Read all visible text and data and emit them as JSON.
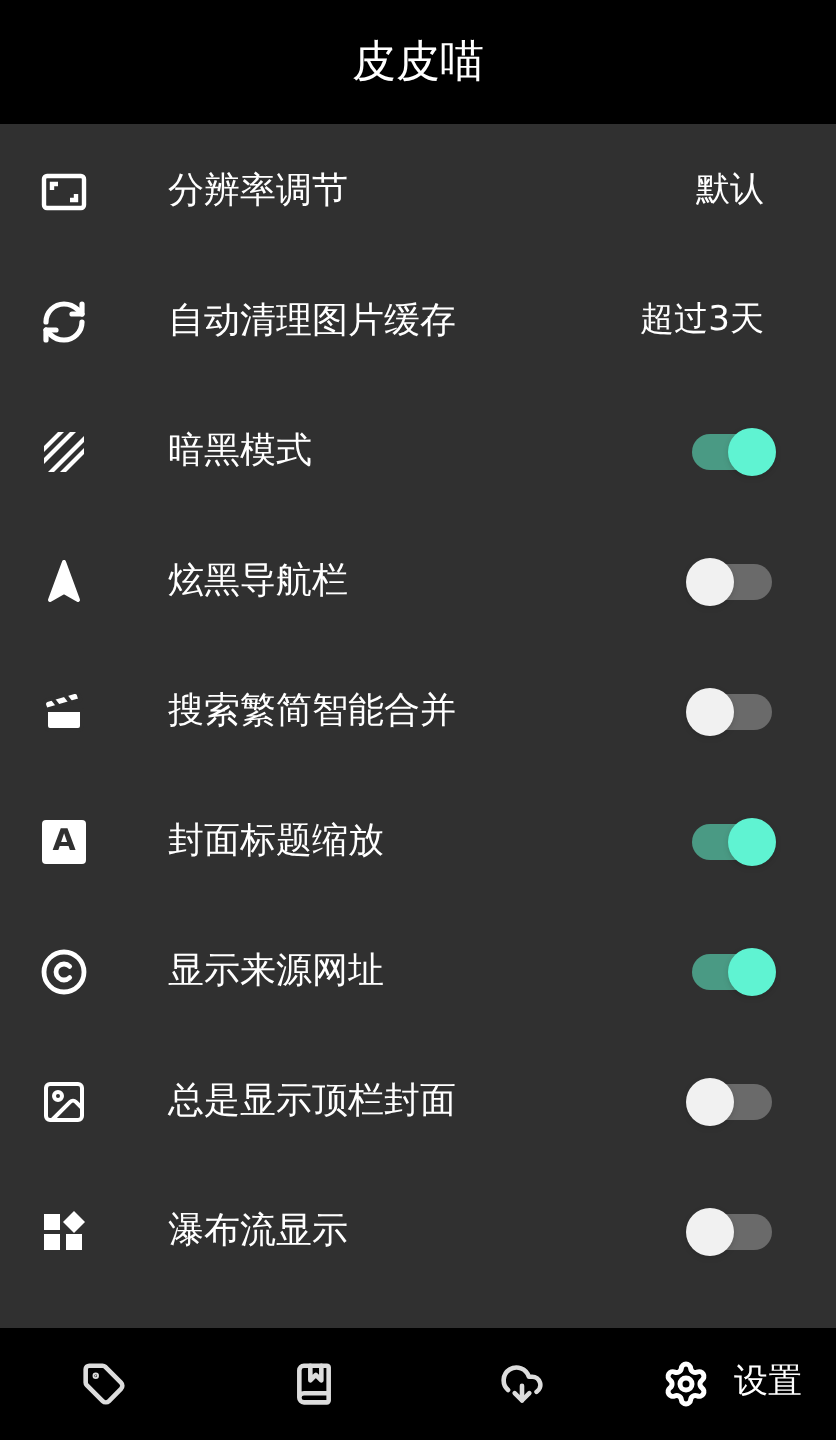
{
  "header": {
    "title": "皮皮喵"
  },
  "settings": [
    {
      "kind": "value",
      "label": "分辨率调节",
      "value": "默认"
    },
    {
      "kind": "value",
      "label": "自动清理图片缓存",
      "value": "超过3天"
    },
    {
      "kind": "toggle",
      "label": "暗黑模式",
      "on": true
    },
    {
      "kind": "toggle",
      "label": "炫黑导航栏",
      "on": false
    },
    {
      "kind": "toggle",
      "label": "搜索繁简智能合并",
      "on": false
    },
    {
      "kind": "toggle",
      "label": "封面标题缩放",
      "on": true,
      "icon_text": "A"
    },
    {
      "kind": "toggle",
      "label": "显示来源网址",
      "on": true
    },
    {
      "kind": "toggle",
      "label": "总是显示顶栏封面",
      "on": false
    },
    {
      "kind": "toggle",
      "label": "瀑布流显示",
      "on": false
    }
  ],
  "bottom_nav": [
    {
      "selected": false
    },
    {
      "selected": false
    },
    {
      "selected": false
    },
    {
      "selected": true,
      "label": "设置"
    }
  ]
}
